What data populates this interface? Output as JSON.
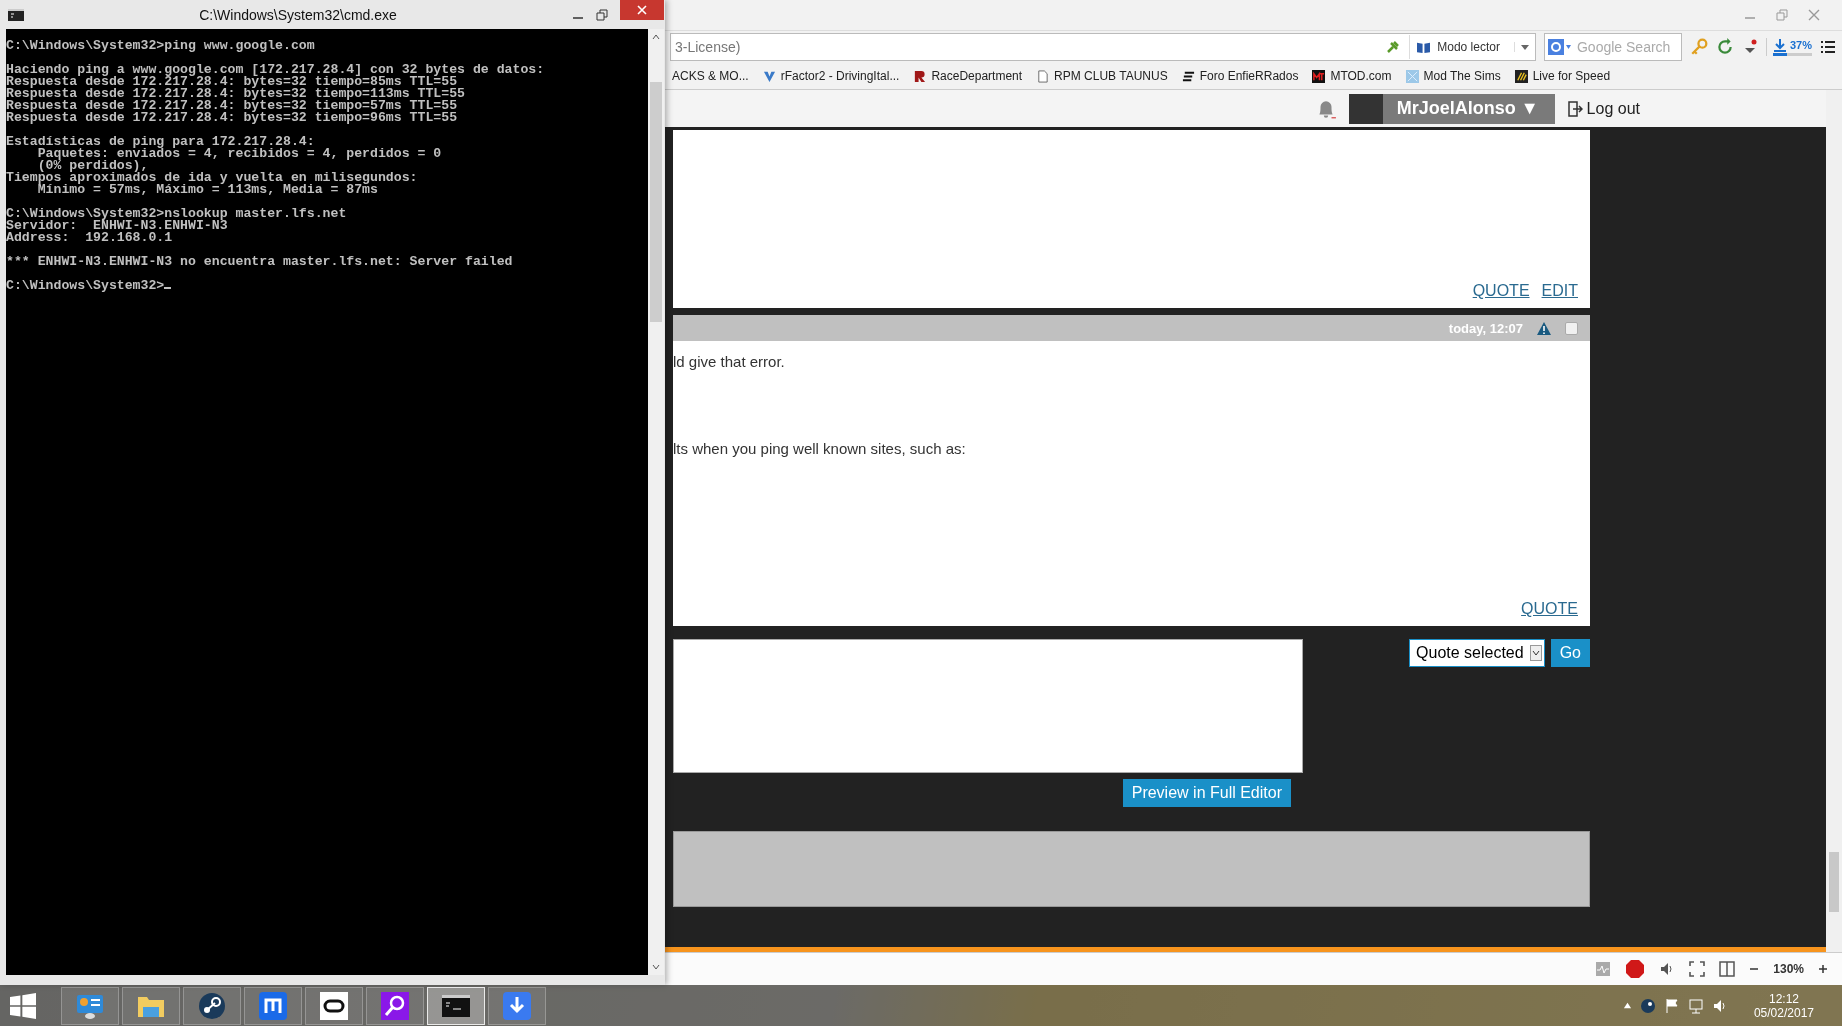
{
  "cmd_window": {
    "title": "C:\\Windows\\System32\\cmd.exe",
    "blocks": [
      [
        "C:\\Windows\\System32>ping www.google.com"
      ],
      [
        "Haciendo ping a www.google.com [172.217.28.4] con 32 bytes de datos:",
        "Respuesta desde 172.217.28.4: bytes=32 tiempo=85ms TTL=55",
        "Respuesta desde 172.217.28.4: bytes=32 tiempo=113ms TTL=55",
        "Respuesta desde 172.217.28.4: bytes=32 tiempo=57ms TTL=55",
        "Respuesta desde 172.217.28.4: bytes=32 tiempo=96ms TTL=55"
      ],
      [
        "Estadísticas de ping para 172.217.28.4:",
        "    Paquetes: enviados = 4, recibidos = 4, perdidos = 0",
        "    (0% perdidos),",
        "Tiempos aproximados de ida y vuelta en milisegundos:",
        "    Mínimo = 57ms, Máximo = 113ms, Media = 87ms"
      ],
      [
        "C:\\Windows\\System32>nslookup master.lfs.net",
        "Servidor:  ENHWI-N3.ENHWI-N3",
        "Address:  192.168.0.1"
      ],
      [
        "*** ENHWI-N3.ENHWI-N3 no encuentra master.lfs.net: Server failed"
      ]
    ],
    "prompt": "C:\\Windows\\System32>"
  },
  "browser": {
    "address": "3-License)",
    "reader_mode": "Modo lector",
    "search_placeholder": "Google Search",
    "download": {
      "label": "37%",
      "level": 0.37
    },
    "bookmarks": [
      {
        "label": "ACKS & MO...",
        "kind": "none"
      },
      {
        "label": "rFactor2 - DrivingItal...",
        "kind": "v"
      },
      {
        "label": "RaceDepartment",
        "kind": "r"
      },
      {
        "label": "RPM CLUB TAUNUS",
        "kind": "page"
      },
      {
        "label": "Foro EnfieRRados",
        "kind": "stripes"
      },
      {
        "label": "MTOD.com",
        "kind": "mt"
      },
      {
        "label": "Mod The Sims",
        "kind": "tile"
      },
      {
        "label": "Live for Speed",
        "kind": "lfs"
      }
    ],
    "header": {
      "username": "MrJoelAlonso ▼",
      "logout": "Log out"
    },
    "posts": [
      {
        "actions": [
          "QUOTE",
          "EDIT"
        ]
      },
      {
        "time": "today, 12:07",
        "checked": false,
        "paragraphs": [
          "ld give that error.",
          "lts when you ping well known sites, such as:"
        ],
        "actions": [
          "QUOTE"
        ]
      }
    ],
    "quick_reply": {
      "select": "Quote selected",
      "go": "Go",
      "preview": "Preview in Full Editor"
    },
    "zoom": "130%"
  },
  "taskbar": {
    "apps": [
      {
        "kind": "panel",
        "selected": false
      },
      {
        "kind": "folder",
        "selected": false
      },
      {
        "kind": "steam",
        "selected": false
      },
      {
        "kind": "m",
        "selected": false
      },
      {
        "kind": "ring",
        "selected": false
      },
      {
        "kind": "search",
        "selected": false
      },
      {
        "kind": "terminal",
        "selected": true
      },
      {
        "kind": "download",
        "selected": false
      }
    ],
    "time": "12:12",
    "date": "05/02/2017"
  }
}
